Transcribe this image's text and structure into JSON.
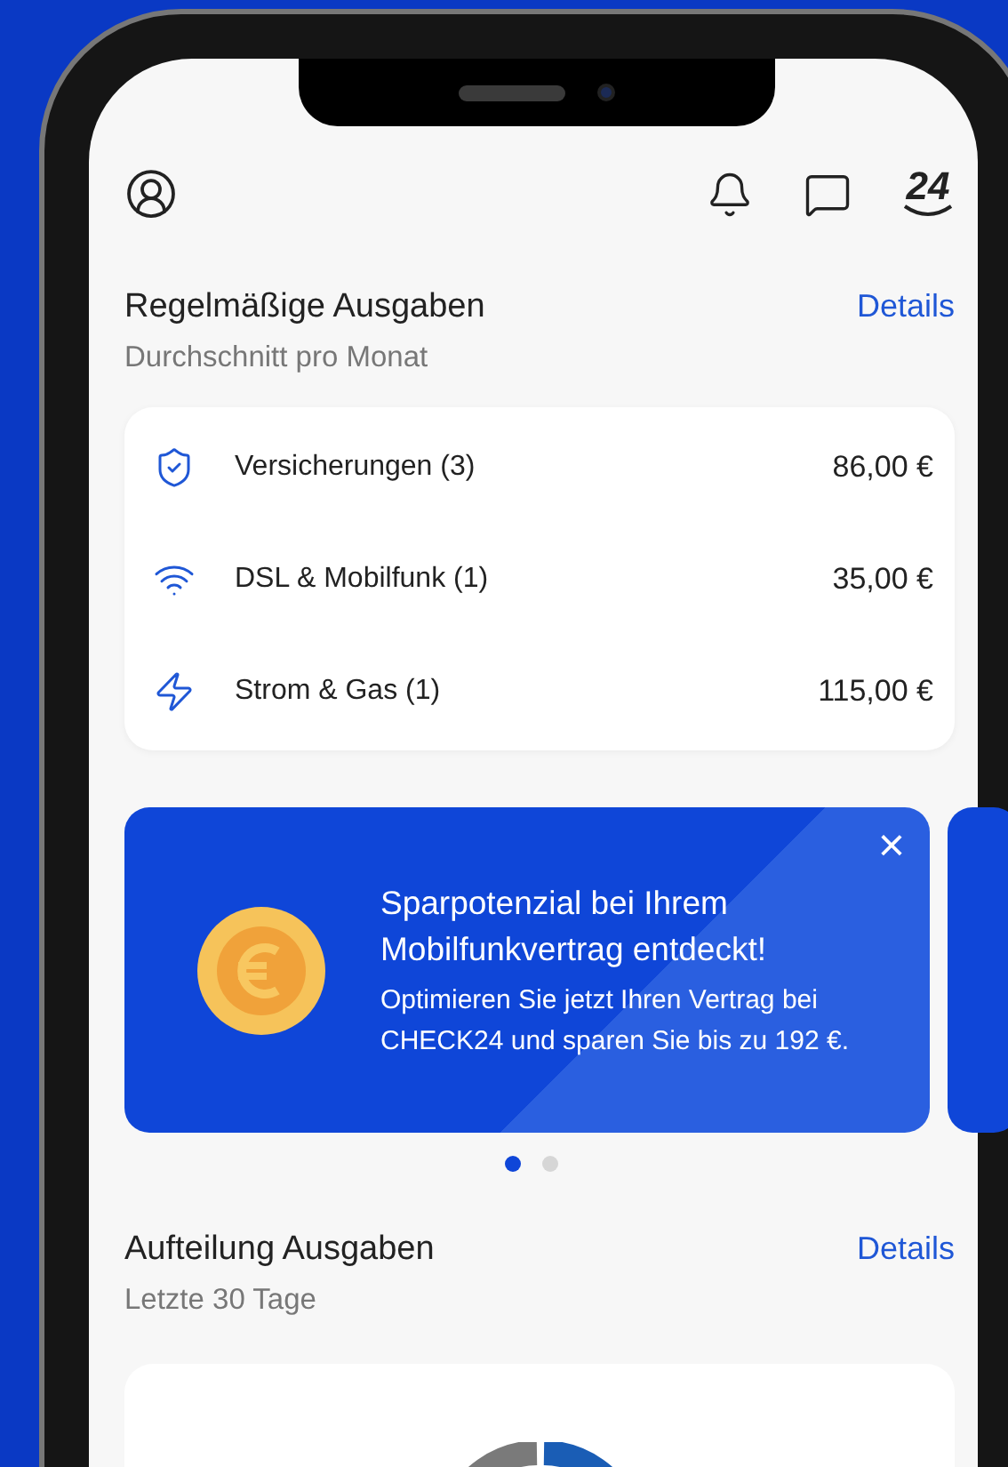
{
  "header": {
    "logo_text": "24"
  },
  "recurring": {
    "title": "Regelmäßige Ausgaben",
    "subtitle": "Durchschnitt pro Monat",
    "link": "Details",
    "items": [
      {
        "label": "Versicherungen (3)",
        "amount": "86,00 €"
      },
      {
        "label": "DSL & Mobilfunk (1)",
        "amount": "35,00 €"
      },
      {
        "label": "Strom & Gas (1)",
        "amount": "115,00 €"
      }
    ]
  },
  "promo": {
    "title": "Sparpotenzial bei Ihrem Mobilfunkvertrag entdeckt!",
    "body": "Optimieren Sie jetzt Ihren Vertrag bei CHECK24 und sparen Sie bis zu 192 €.",
    "close": "×",
    "pager": [
      {
        "selected": true
      },
      {
        "selected": false
      }
    ]
  },
  "breakdown": {
    "title": "Aufteilung Ausgaben",
    "subtitle": "Letzte 30 Tage",
    "link": "Details"
  }
}
